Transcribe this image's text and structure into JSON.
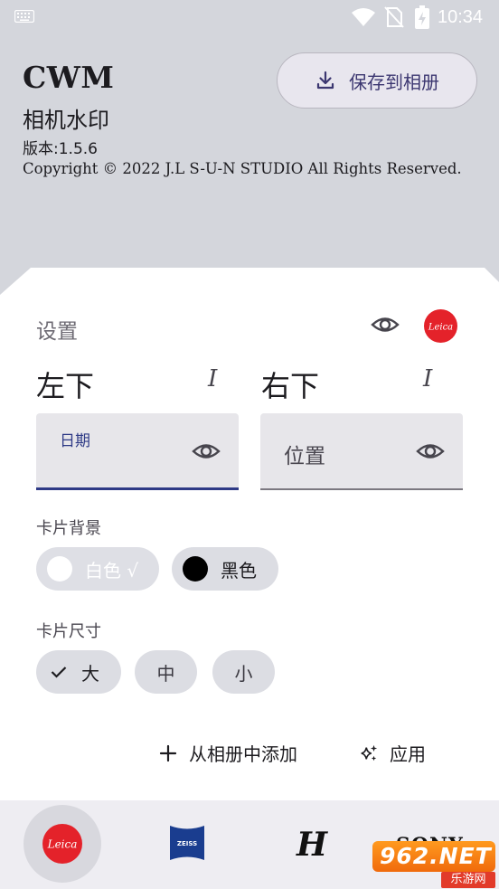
{
  "status_bar": {
    "time": "10:34"
  },
  "header": {
    "app_name": "CWM",
    "subtitle": "相机水印",
    "version": "版本:1.5.6",
    "copyright": "Copyright © 2022 J.L S-U-N STUDIO All Rights Reserved.",
    "save_button": "保存到相册"
  },
  "settings": {
    "title": "设置",
    "left_position": {
      "label": "左下",
      "field_label": "日期",
      "field_value": ""
    },
    "right_position": {
      "label": "右下",
      "field_value": "位置"
    },
    "text_icon_glyph": "I",
    "card_background": {
      "label": "卡片背景",
      "options": [
        {
          "label": "白色 √",
          "color": "#ffffff",
          "selected": true
        },
        {
          "label": "黑色",
          "color": "#000000",
          "selected": false
        }
      ]
    },
    "card_size": {
      "label": "卡片尺寸",
      "options": [
        {
          "label": "大",
          "selected": true
        },
        {
          "label": "中",
          "selected": false
        },
        {
          "label": "小",
          "selected": false
        }
      ]
    },
    "add_from_album": "从相册中添加",
    "apply": "应用"
  },
  "brands": {
    "leica_text": "Leica",
    "zeiss_text": "ZEISS",
    "hassel_text": "H",
    "sony_text": "SONY",
    "selected": "leica"
  },
  "watermark": {
    "text": "962.NET",
    "sub": "乐游网"
  },
  "colors": {
    "accent": "#2e3a86",
    "leica_red": "#e4222a",
    "background": "#d4d6dc"
  }
}
